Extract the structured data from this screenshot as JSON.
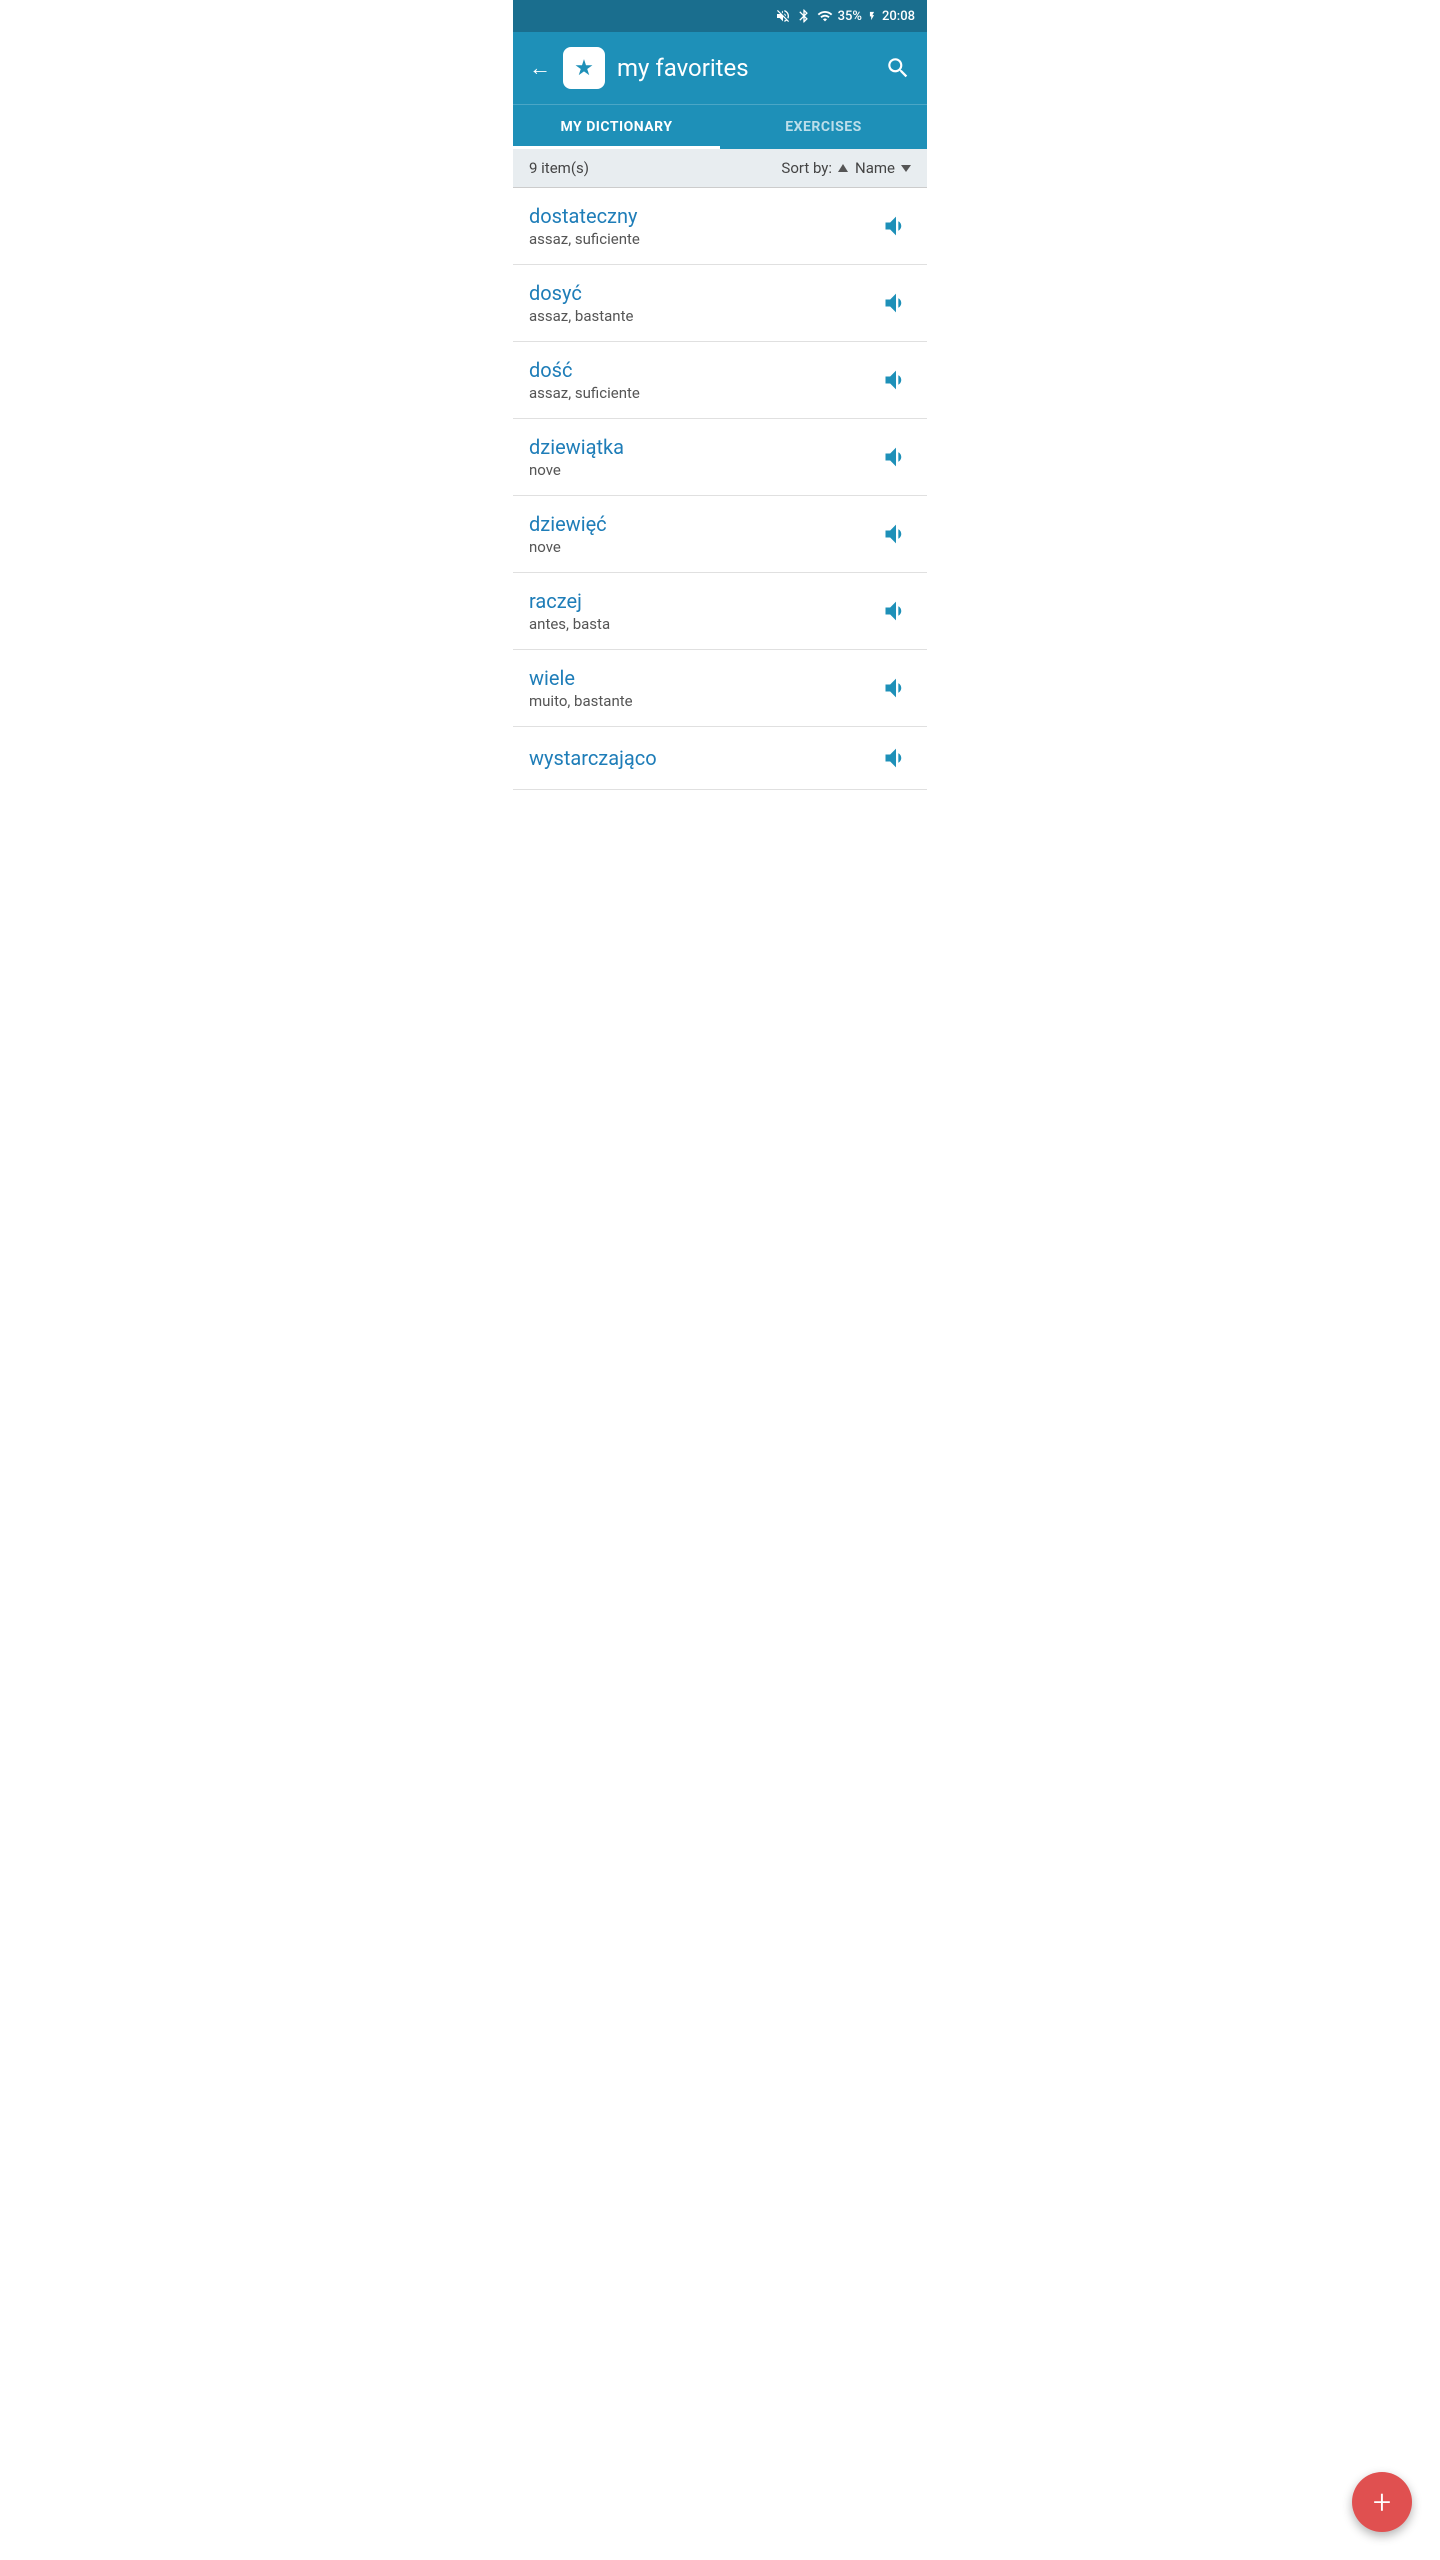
{
  "status_bar": {
    "battery": "35%",
    "time": "20:08"
  },
  "header": {
    "back_label": "←",
    "title": "my favorites",
    "star_icon": "★",
    "search_icon": "search"
  },
  "tabs": [
    {
      "label": "MY DICTIONARY",
      "active": true
    },
    {
      "label": "EXERCISES",
      "active": false
    }
  ],
  "sort_bar": {
    "count": "9 item(s)",
    "sort_by_label": "Sort by:",
    "sort_field": "Name"
  },
  "dictionary_items": [
    {
      "word": "dostateczny",
      "translation": "assaz, suficiente"
    },
    {
      "word": "dosyć",
      "translation": "assaz, bastante"
    },
    {
      "word": "dość",
      "translation": "assaz, suficiente"
    },
    {
      "word": "dziewiątka",
      "translation": "nove"
    },
    {
      "word": "dziewięć",
      "translation": "nove"
    },
    {
      "word": "raczej",
      "translation": "antes, basta"
    },
    {
      "word": "wiele",
      "translation": "muito, bastante"
    },
    {
      "word": "wystarczająco",
      "translation": ""
    }
  ],
  "fab": {
    "label": "+"
  }
}
